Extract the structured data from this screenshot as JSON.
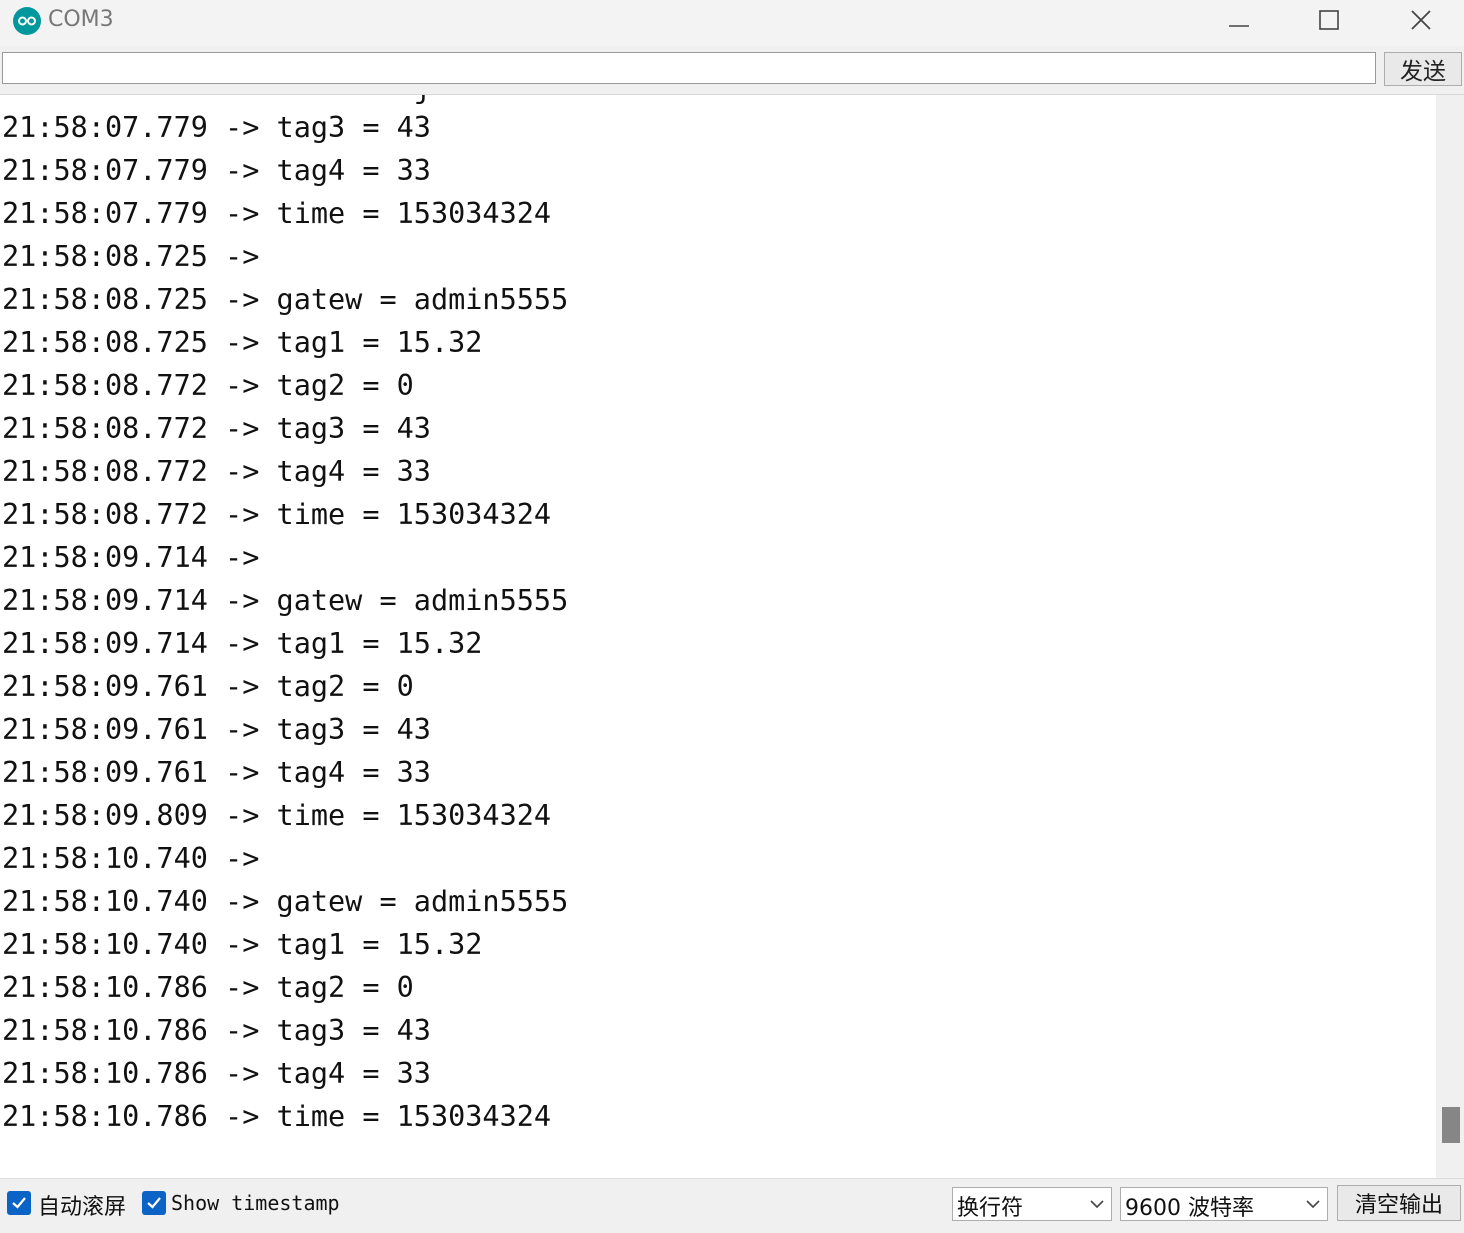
{
  "window": {
    "title": "COM3"
  },
  "send": {
    "input_value": "",
    "button_label": "发送"
  },
  "output": {
    "partial_top_line": "                        j",
    "lines": [
      "21:58:07.779 -> tag3 = 43",
      "21:58:07.779 -> tag4 = 33",
      "21:58:07.779 -> time = 153034324",
      "21:58:08.725 ->",
      "21:58:08.725 -> gatew = admin5555",
      "21:58:08.725 -> tag1 = 15.32",
      "21:58:08.772 -> tag2 = 0",
      "21:58:08.772 -> tag3 = 43",
      "21:58:08.772 -> tag4 = 33",
      "21:58:08.772 -> time = 153034324",
      "21:58:09.714 ->",
      "21:58:09.714 -> gatew = admin5555",
      "21:58:09.714 -> tag1 = 15.32",
      "21:58:09.761 -> tag2 = 0",
      "21:58:09.761 -> tag3 = 43",
      "21:58:09.761 -> tag4 = 33",
      "21:58:09.809 -> time = 153034324",
      "21:58:10.740 ->",
      "21:58:10.740 -> gatew = admin5555",
      "21:58:10.740 -> tag1 = 15.32",
      "21:58:10.786 -> tag2 = 0",
      "21:58:10.786 -> tag3 = 43",
      "21:58:10.786 -> tag4 = 33",
      "21:58:10.786 -> time = 153034324"
    ]
  },
  "footer": {
    "autoscroll": {
      "label": "自动滚屏",
      "checked": true
    },
    "timestamp": {
      "label": "Show timestamp",
      "checked": true
    },
    "line_ending": {
      "value": "换行符"
    },
    "baud_rate": {
      "value": "9600 波特率"
    },
    "clear_button_label": "清空输出"
  },
  "colors": {
    "accent": "#0b63c5",
    "app_icon": "#00979d"
  }
}
